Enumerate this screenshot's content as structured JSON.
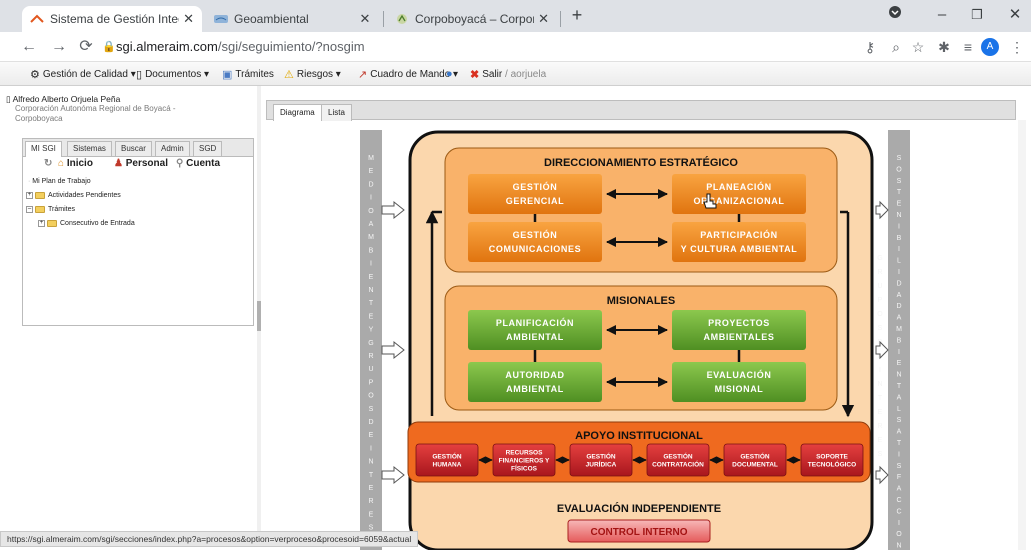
{
  "browser": {
    "tabs": [
      {
        "title": "Sistema de Gestión Integral - Alm",
        "icon": "sgi-favicon",
        "active": true
      },
      {
        "title": "Geoambiental",
        "icon": "geo-favicon",
        "active": false
      },
      {
        "title": "Corpoboyacá – Corporación Autó",
        "icon": "corpo-favicon",
        "active": false
      }
    ],
    "url_host": "sgi.almeraim.com",
    "url_path": "/sgi/seguimiento/?nosgim",
    "profile_initial": "A"
  },
  "menu": {
    "items": [
      {
        "label": "Gestión de Calidad",
        "icon": "quality-icon",
        "dropdown": true
      },
      {
        "label": "Documentos",
        "icon": "documents-icon",
        "dropdown": true
      },
      {
        "label": "Trámites",
        "icon": "procedures-icon",
        "dropdown": false
      },
      {
        "label": "Riesgos",
        "icon": "warning-icon",
        "dropdown": true
      },
      {
        "label": "Cuadro de Mando",
        "icon": "dashboard-icon",
        "dropdown": true
      }
    ],
    "exit_label": "Salir",
    "user_short": "/ aorjuela"
  },
  "user": {
    "name": "Alfredo Alberto Orjuela Peña",
    "org_line1": "Corporación Autonóma Regional de Boyacá -",
    "org_line2": "Corpoboyaca"
  },
  "left_tabs": [
    "MI SGI",
    "Sistemas",
    "Buscar",
    "Admin",
    "SGD"
  ],
  "left_buttons": {
    "home": "Inicio",
    "personal": "Personal",
    "account": "Cuenta"
  },
  "tree": {
    "root": "Mi Plan de Trabajo",
    "pending": "Actividades Pendientes",
    "procedures": "Trámites",
    "entry": "Consecutivo de Entrada"
  },
  "right_tabs": [
    "Diagrama",
    "Lista"
  ],
  "diagram": {
    "left_column": "MEDIOAMBIENTEYGRUPOSDEINTERES",
    "right_column": "SOSTENIBILIDADAMBIENTALSATISFACCION",
    "right_column2": "GRUPOSDEINTERES",
    "strategic_title": "DIRECCIONAMIENTO ESTRATÉGICO",
    "strategic": [
      [
        "GESTIÓN",
        "GERENCIAL"
      ],
      [
        "PLANEACIÓN",
        "ORGANIZACIONAL"
      ],
      [
        "GESTIÓN",
        "COMUNICACIONES"
      ],
      [
        "PARTICIPACIÓN",
        "Y CULTURA AMBIENTAL"
      ]
    ],
    "missional_title": "MISIONALES",
    "missional": [
      [
        "PLANIFICACIÓN",
        "AMBIENTAL"
      ],
      [
        "PROYECTOS",
        "AMBIENTALES"
      ],
      [
        "AUTORIDAD",
        "AMBIENTAL"
      ],
      [
        "EVALUACIÓN",
        "MISIONAL"
      ]
    ],
    "support_title": "APOYO INSTITUCIONAL",
    "support": [
      [
        "GESTIÓN",
        "HUMANA"
      ],
      [
        "RECURSOS",
        "FINANCIEROS Y",
        "FÍSICOS"
      ],
      [
        "GESTIÓN",
        "JURÍDICA"
      ],
      [
        "GESTIÓN",
        "CONTRATACIÓN"
      ],
      [
        "GESTIÓN",
        "DOCUMENTAL"
      ],
      [
        "SOPORTE",
        "TECNOLÓGICO"
      ]
    ],
    "evaluation_title": "EVALUACIÓN INDEPENDIENTE",
    "control_label": "CONTROL INTERNO"
  },
  "status_url": "https://sgi.almeraim.com/sgi/secciones/index.php?a=procesos&option=verproceso&procesoid=6059&actual",
  "colors": {
    "orange_box": "#f28a1e",
    "green_box": "#6fae35",
    "red_box": "#c9222a",
    "panel_fill": "#fbd2a4",
    "side_column": "#a9a9a9"
  }
}
